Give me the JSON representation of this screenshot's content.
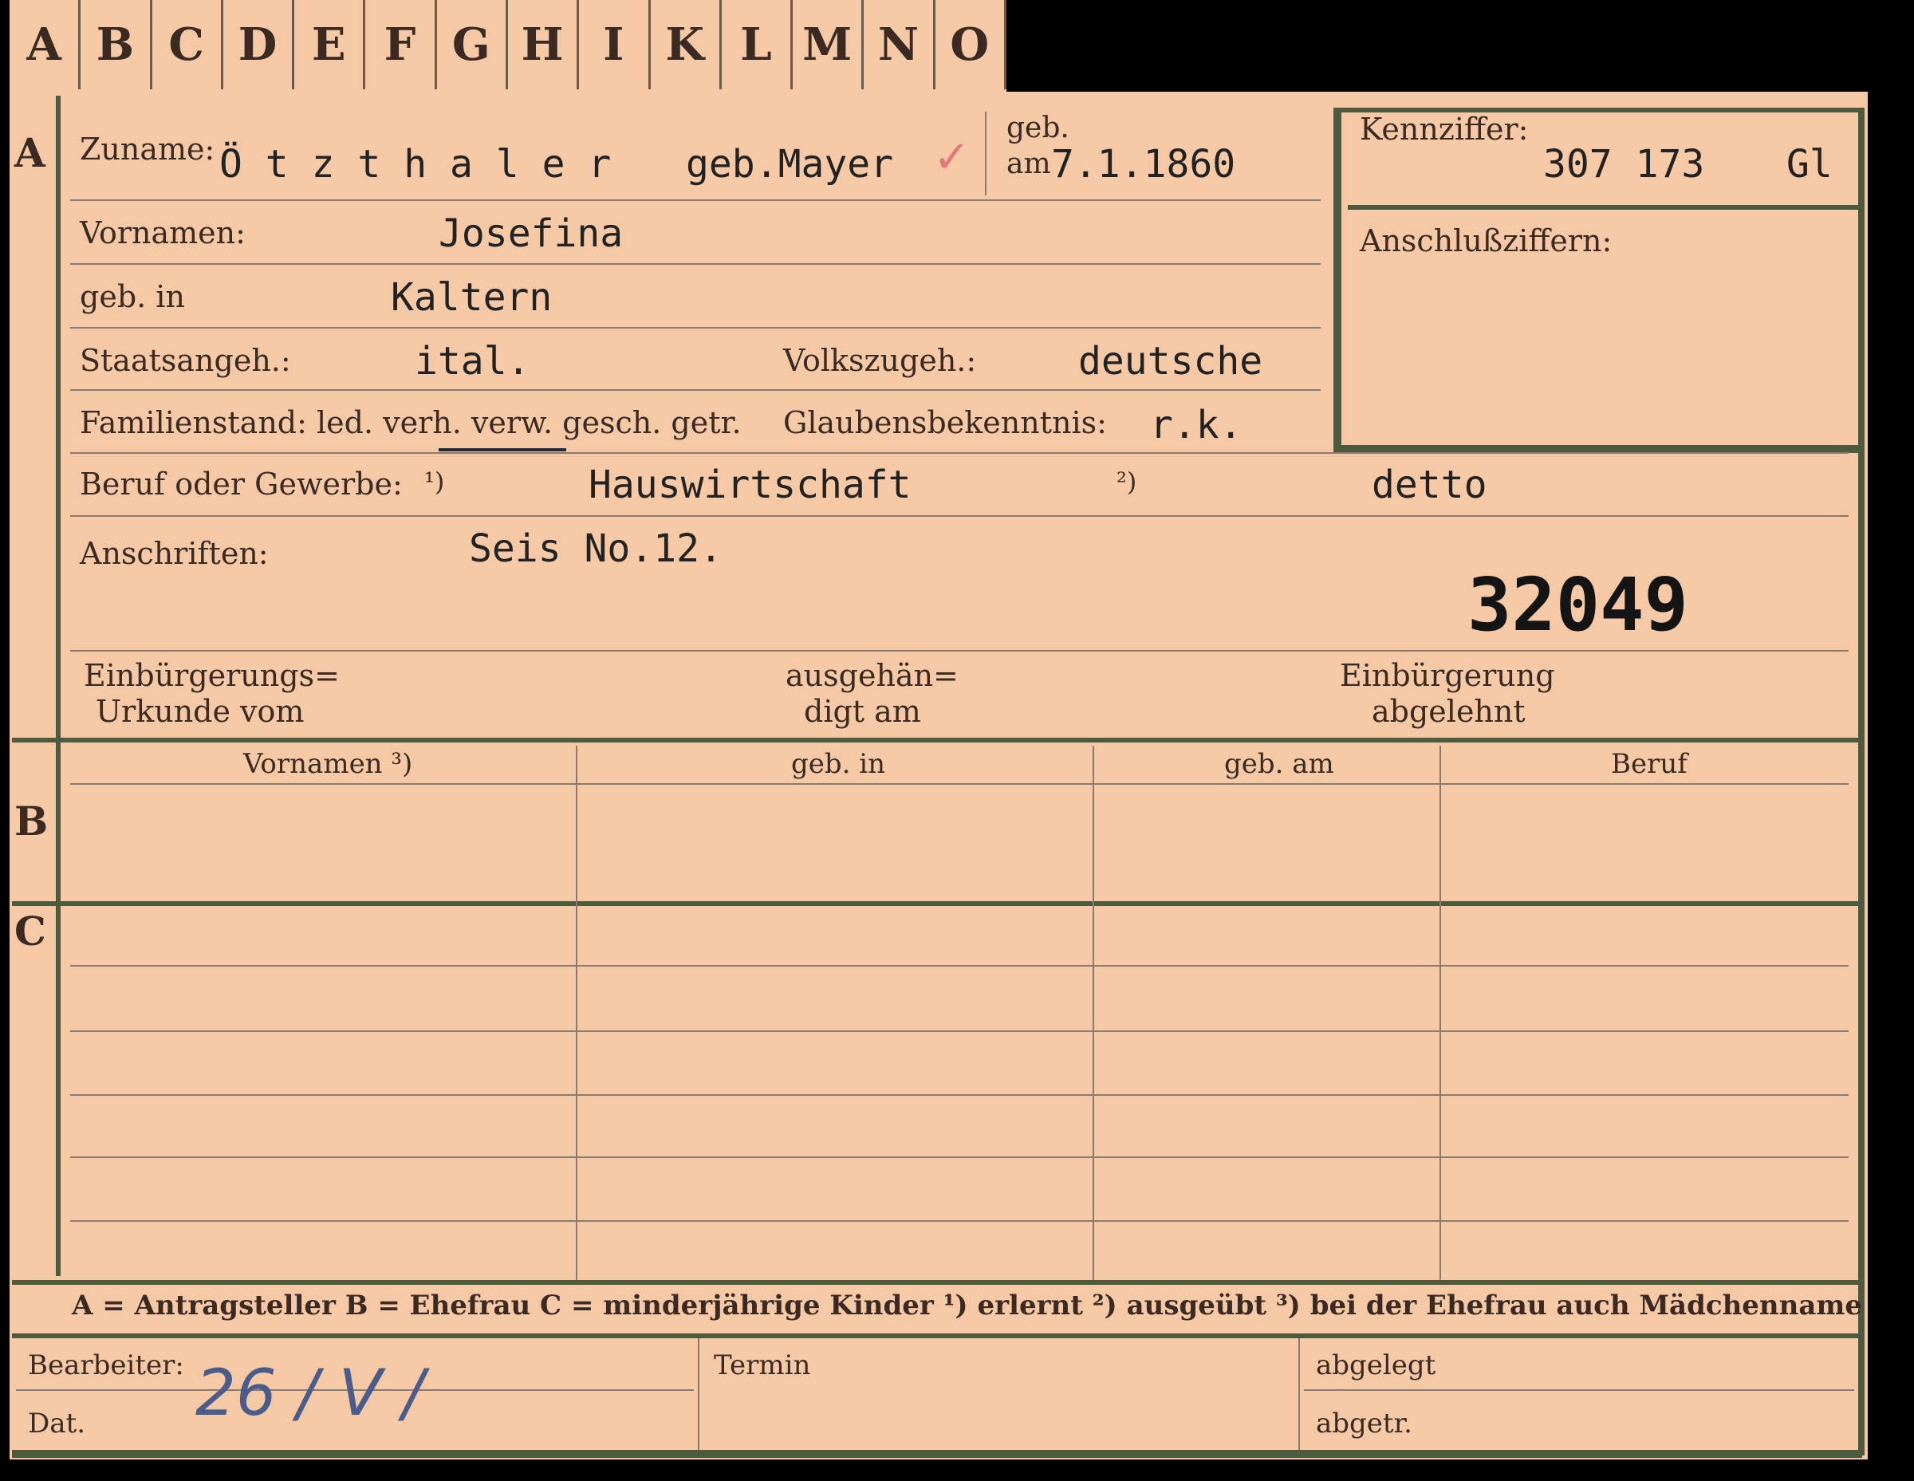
{
  "tabs": [
    "A",
    "B",
    "C",
    "D",
    "E",
    "F",
    "G",
    "H",
    "I",
    "K",
    "L",
    "M",
    "N",
    "O"
  ],
  "sections": {
    "a": "A",
    "b": "B",
    "c": "C"
  },
  "person": {
    "zuname_label": "Zuname:",
    "zuname_value": "Ö t z t h a l e r",
    "geb_mayer": "geb.Mayer",
    "checkmark": "✓",
    "geb_am_label_1": "geb.",
    "geb_am_label_2": "am",
    "geb_am_value": "7.1.1860",
    "vornamen_label": "Vornamen:",
    "vornamen_value": "Josefina",
    "geb_in_label": "geb. in",
    "geb_in_value": "Kaltern",
    "staatsangeh_label": "Staatsangeh.:",
    "staatsangeh_value": "ital.",
    "volkszugeh_label": "Volkszugeh.:",
    "volkszugeh_value": "deutsche",
    "familienstand_label": "Familienstand: led. verh. verw. gesch. getr.",
    "glaubens_label": "Glaubensbekenntnis:",
    "glaubens_value": "r.k.",
    "beruf_label": "Beruf oder Gewerbe:",
    "beruf_fn1": "¹)",
    "beruf_value": "Hauswirtschaft",
    "beruf_fn2": "²)",
    "beruf_value2": "detto",
    "anschriften_label": "Anschriften:",
    "anschriften_value": "Seis No.12.",
    "number_stamp": "32049",
    "einb_urkunde_1": "Einbürgerungs=",
    "einb_urkunde_2": "Urkunde vom",
    "ausgehaendigt_1": "ausgehän=",
    "ausgehaendigt_2": "digt am",
    "einb_abgelehnt_1": "Einbürgerung",
    "einb_abgelehnt_2": "abgelehnt"
  },
  "kennziffer": {
    "label": "Kennziffer:",
    "value": "307 173",
    "suffix": "Gl",
    "anschluss_label": "Anschlußziffern:"
  },
  "table": {
    "headers": [
      "Vornamen ³)",
      "geb. in",
      "geb. am",
      "Beruf"
    ]
  },
  "legend": "A = Antragsteller   B = Ehefrau   C = minderjährige Kinder   ¹) erlernt   ²) ausgeübt   ³) bei der Ehefrau auch Mädchenname",
  "footer": {
    "bearbeiter_label": "Bearbeiter:",
    "dat_label": "Dat.",
    "dat_value": "26 / V /",
    "termin_label": "Termin",
    "abgelegt_label": "abgelegt",
    "abgetr_label": "abgetr."
  }
}
